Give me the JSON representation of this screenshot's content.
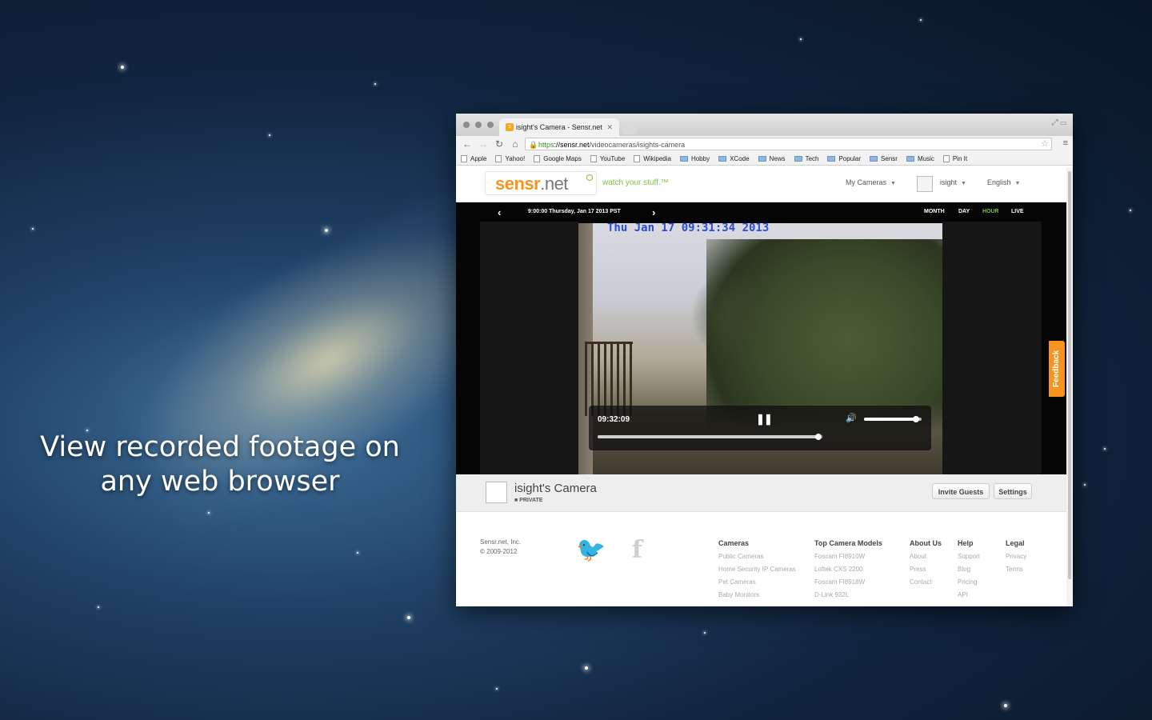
{
  "caption": {
    "line1": "View recorded footage on",
    "line2": "any web browser"
  },
  "browser": {
    "tab_title": "isight's Camera - Sensr.net",
    "tab_favicon_letter": "s",
    "url_scheme": "https",
    "url_domain": "://sensr.net",
    "url_path": "/videocameras/isights-camera",
    "bookmarks": [
      {
        "label": "Apple",
        "type": "page"
      },
      {
        "label": "Yahoo!",
        "type": "page"
      },
      {
        "label": "Google Maps",
        "type": "page"
      },
      {
        "label": "YouTube",
        "type": "page"
      },
      {
        "label": "Wikipedia",
        "type": "page"
      },
      {
        "label": "Hobby",
        "type": "folder"
      },
      {
        "label": "XCode",
        "type": "folder"
      },
      {
        "label": "News",
        "type": "folder"
      },
      {
        "label": "Tech",
        "type": "folder"
      },
      {
        "label": "Popular",
        "type": "folder"
      },
      {
        "label": "Sensr",
        "type": "folder"
      },
      {
        "label": "Music",
        "type": "folder"
      },
      {
        "label": "Pin It",
        "type": "page"
      }
    ]
  },
  "site": {
    "logo_sensr": "sensr",
    "logo_net": ".net",
    "tagline": "watch your stuff.™",
    "nav": {
      "my_cameras": "My Cameras",
      "user": "isight",
      "language": "English"
    },
    "accent_color": "#f7941d",
    "tagline_color": "#7cc242"
  },
  "player": {
    "range_label": "9:00:00 Thursday, Jan 17 2013 PST",
    "prev": "‹",
    "next": "›",
    "views": [
      "MONTH",
      "DAY",
      "HOUR",
      "LIVE"
    ],
    "active_view": "HOUR",
    "active_color": "#7cc242",
    "overlay_timestamp": "Thu Jan 17 09:31:34 2013",
    "current_time": "09:32:09",
    "pause_icon": "❚❚",
    "volume_icon": "🔊",
    "volume_level": 0.9,
    "seek_progress": 0.98
  },
  "feedback_label": "Feedback",
  "camera": {
    "name": "isight's Camera",
    "privacy": "■ PRIVATE",
    "invite_label": "Invite Guests",
    "settings_label": "Settings"
  },
  "footer": {
    "company": "Sensr.net, Inc.",
    "copyright": "© 2009-2012",
    "columns": [
      {
        "head": "Cameras",
        "links": [
          "Public Cameras",
          "Home Security IP Cameras",
          "Pet Cameras",
          "Baby Monitors"
        ]
      },
      {
        "head": "Top Camera Models",
        "links": [
          "Foscam FI8910W",
          "Loftek CXS 2200",
          "Foscam FI8918W",
          "D-Link 932L"
        ]
      },
      {
        "head": "About Us",
        "links": [
          "About",
          "Press",
          "Contact"
        ]
      },
      {
        "head": "Help",
        "links": [
          "Support",
          "Blog",
          "Pricing",
          "API"
        ]
      },
      {
        "head": "Legal",
        "links": [
          "Privacy",
          "Terms"
        ]
      }
    ]
  }
}
